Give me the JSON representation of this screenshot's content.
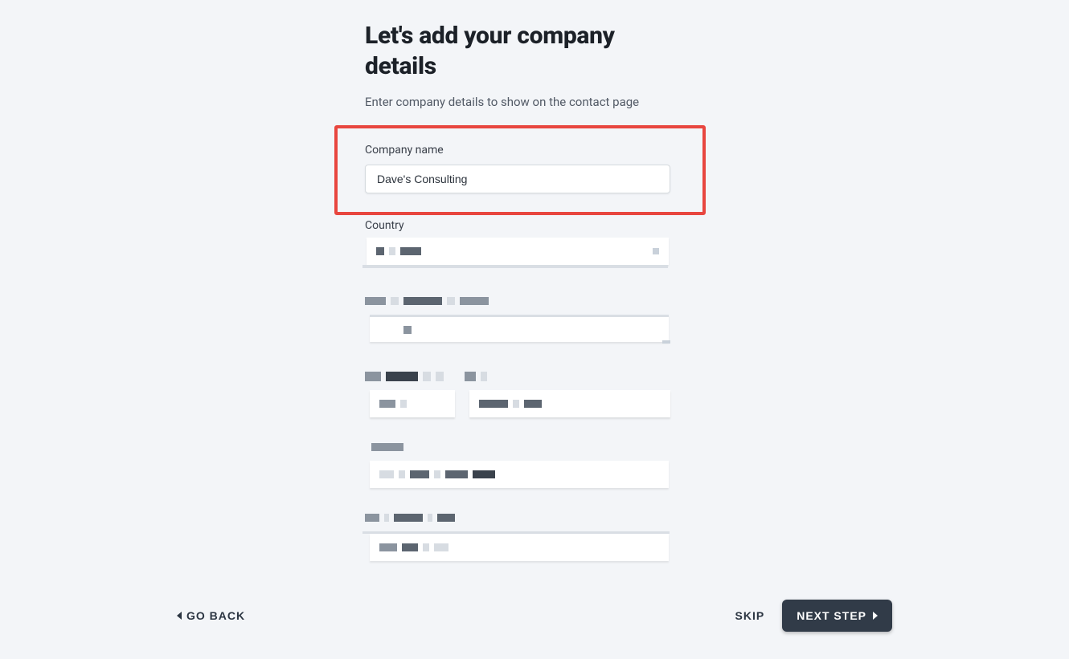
{
  "heading": "Let's add your company details",
  "subheading": "Enter company details to show on the contact page",
  "company_name": {
    "label": "Company name",
    "value": "Dave's Consulting"
  },
  "country": {
    "label": "Country"
  },
  "buttons": {
    "go_back": "GO BACK",
    "skip": "SKIP",
    "next_step": "NEXT STEP"
  }
}
